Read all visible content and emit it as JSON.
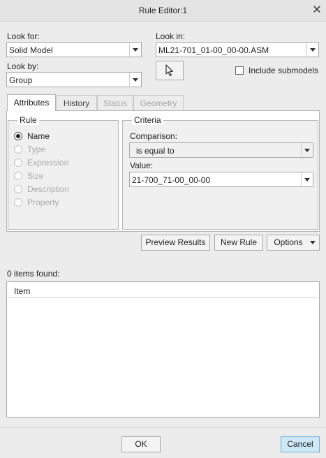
{
  "window": {
    "title": "Rule Editor:1",
    "close_glyph": "✕"
  },
  "look_for": {
    "label": "Look for:",
    "value": "Solid Model"
  },
  "look_by": {
    "label": "Look by:",
    "value": "Group"
  },
  "look_in": {
    "label": "Look in:",
    "value": "ML21-701_01-00_00-00.ASM"
  },
  "select_button_icon": "arrow-cursor-icon",
  "include_submodels": {
    "label": "Include submodels",
    "checked": false
  },
  "tabs": [
    {
      "label": "Attributes",
      "active": true,
      "enabled": true
    },
    {
      "label": "History",
      "active": false,
      "enabled": true
    },
    {
      "label": "Status",
      "active": false,
      "enabled": false
    },
    {
      "label": "Geometry",
      "active": false,
      "enabled": false
    }
  ],
  "rule": {
    "legend": "Rule",
    "options": [
      {
        "label": "Name",
        "selected": true,
        "enabled": true
      },
      {
        "label": "Type",
        "selected": false,
        "enabled": false
      },
      {
        "label": "Expression",
        "selected": false,
        "enabled": false
      },
      {
        "label": "Size",
        "selected": false,
        "enabled": false
      },
      {
        "label": "Description",
        "selected": false,
        "enabled": false
      },
      {
        "label": "Property",
        "selected": false,
        "enabled": false
      }
    ]
  },
  "criteria": {
    "legend": "Criteria",
    "comparison_label": "Comparison:",
    "comparison_value": "is equal to",
    "value_label": "Value:",
    "value_value": "21-700_71-00_00-00"
  },
  "actions": {
    "preview": "Preview Results",
    "new_rule": "New Rule",
    "options": "Options"
  },
  "results": {
    "count_text": "0 items found:",
    "column_header": "Item",
    "rows": []
  },
  "footer": {
    "ok": "OK",
    "cancel": "Cancel"
  },
  "colors": {
    "cancel_bg": "#cde8f7",
    "cancel_border": "#6ab0dc",
    "window_bg": "#ececec"
  }
}
